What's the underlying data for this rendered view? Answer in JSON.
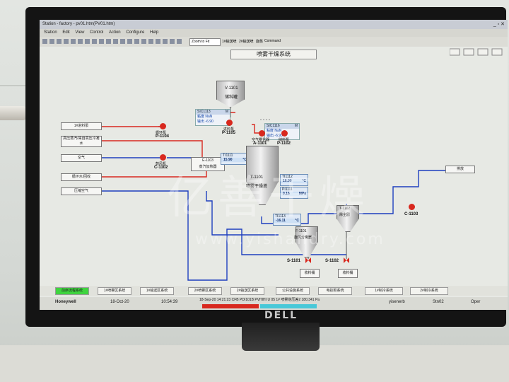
{
  "window": {
    "title": "Station - factory - pv01.htm(PV01.htm)",
    "menu": [
      "Station",
      "Edit",
      "View",
      "Control",
      "Action",
      "Configure",
      "Help"
    ],
    "toolbar_field": "Zoom to Fit",
    "toolbar_tabs": [
      "1#输送喷",
      "2#输送喷",
      "旋蒸",
      "Command"
    ]
  },
  "hmi": {
    "title": "喷雾干燥系统",
    "feed_tank": {
      "id": "V-1101",
      "name": "储料罐"
    },
    "inlet_labels": [
      "1#进料泵",
      "高压蒸汽/来自高压冷凝水",
      "空气",
      "循环水/回收",
      "压缩空气"
    ],
    "pumps": [
      {
        "id": "P-1104"
      },
      {
        "id": "P-1105"
      },
      {
        "id": "A-1101"
      },
      {
        "id": "P-1102"
      },
      {
        "id": "C-1102"
      },
      {
        "id": "C-1103"
      }
    ],
    "pump_captions": [
      "循环泵",
      "进料泵",
      "空气雾化器",
      "储料泵",
      "鼓风机"
    ],
    "heater": {
      "id": "E-1103",
      "name": "蒸汽加热器"
    },
    "dryer": {
      "id": "T-1101",
      "name": "喷雾干燥塔"
    },
    "cyclone1": {
      "id": "F-1101",
      "name": "旋风分离器"
    },
    "cyclone2": {
      "id": "T-1102",
      "name": "除尘器"
    },
    "exhaust": "排放",
    "valves": [
      {
        "id": "S-1101"
      },
      {
        "id": "S-1102"
      }
    ],
    "product_bins": [
      "收料桶",
      "收料桶"
    ],
    "sic1113": {
      "tag": "SIC1113",
      "mode": "M",
      "rows": [
        [
          "粘度",
          "NaN"
        ],
        [
          "输出",
          "-6.90"
        ]
      ]
    },
    "sic1116": {
      "tag": "SIC1116",
      "mode": "M",
      "rows": [
        [
          "粘度",
          "NaN"
        ],
        [
          "输出",
          "-6.90"
        ]
      ]
    },
    "ti1111": {
      "tag": "TI1111",
      "value": "15.90",
      "unit": "°C"
    },
    "ti1112": {
      "tag": "TI1112",
      "value": "16.00",
      "unit": "°C"
    },
    "pi1111": {
      "tag": "PI1111",
      "value": "0.16",
      "unit": "MPa"
    },
    "ti1113": {
      "tag": "TI1113",
      "value": "-16.11",
      "unit": "°C"
    }
  },
  "navbar": [
    "前序流程系统",
    "1#喷雾区系统",
    "1#输送区系统",
    "2#喷雾区系统",
    "2#输送区系统",
    "公共设施系统",
    "电控柜系统",
    "1#制冷系统",
    "2#制冷系统"
  ],
  "status": {
    "brand": "Honeywell",
    "date": "18-Oct-20",
    "time": "10:54:39",
    "alarm": "18-Sep-20  14:21:23  CFB  PDI101B  PVHIHI  U 05 1#  喷雾塔压差2  180.341  Pa",
    "user": "yisenerb",
    "station": "Stn02",
    "mode": "Oper"
  },
  "watermark": {
    "cn": "亿善干燥",
    "url": "www.yishandry.com"
  },
  "colors": {
    "steam_line": "#d8281e",
    "air_line": "#1f3fbf",
    "pump": "#d8281e",
    "nav_active": "#3fd43f"
  }
}
